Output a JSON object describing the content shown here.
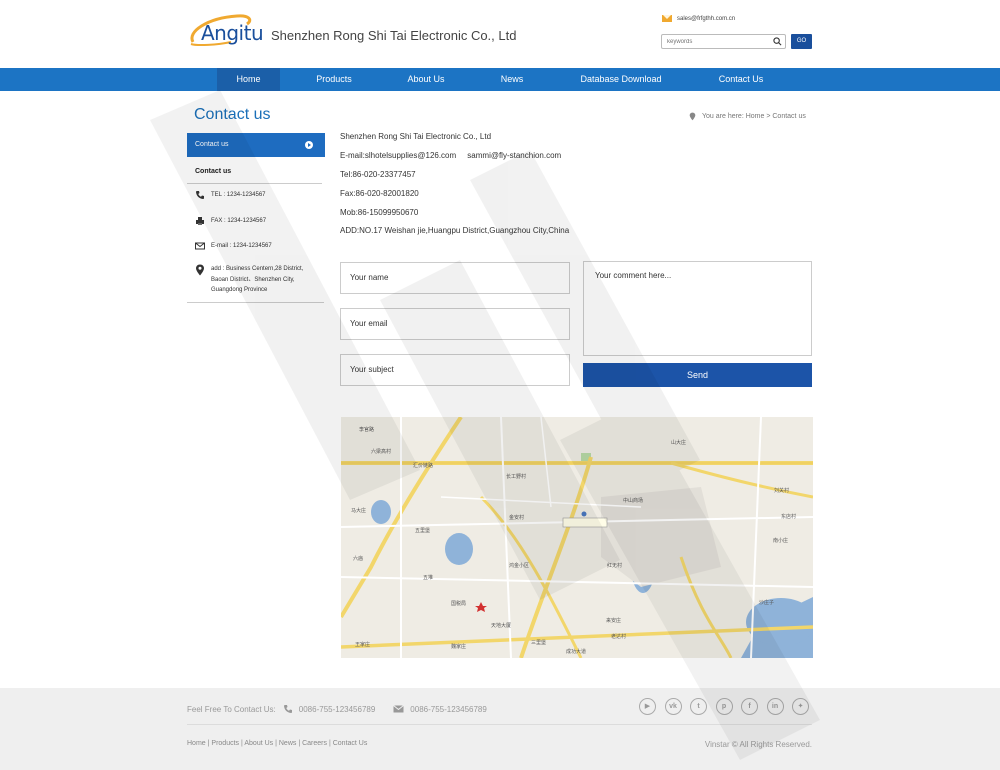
{
  "header": {
    "logo_text": "Angitu",
    "company": "Shenzhen Rong Shi Tai Electronic Co., Ltd",
    "email": "sales@frfgthh.com.cn",
    "search_placeholder": "keywords",
    "go_label": "GO"
  },
  "nav": {
    "items": [
      {
        "label": "Home",
        "active": true
      },
      {
        "label": "Products"
      },
      {
        "label": "About Us"
      },
      {
        "label": "News"
      },
      {
        "label": "Database Download"
      },
      {
        "label": "Contact Us"
      }
    ]
  },
  "sidebar": {
    "page_title": "Contact us",
    "button_label": "Contact us",
    "heading": "Contact us",
    "tel": "TEL : 1234-1234567",
    "fax": "FAX : 1234-1234567",
    "email": "E-mail : 1234-1234567",
    "address": [
      "add : Business Centern,28 District,",
      "Baoan District、Shenzhen City,",
      "Guangdong Province"
    ]
  },
  "breadcrumb": {
    "text": "You are here: Home > Contact us"
  },
  "contact_info": {
    "lines": [
      "Shenzhen Rong Shi Tai Electronic Co., Ltd",
      "E-mail:slhotelsupplies@126.com     sammi@fly-stanchion.com",
      "Tel:86-020-23377457",
      "Fax:86-020-82001820",
      "Mob:86-15099950670",
      "ADD:NO.17 Weishan jie,Huangpu District,Guangzhou City,China"
    ]
  },
  "form": {
    "name_placeholder": "Your name",
    "email_placeholder": "Your email",
    "subject_placeholder": "Your subject",
    "comment_placeholder": "Your comment here...",
    "send_label": "Send"
  },
  "map": {
    "labels": [
      "李官路",
      "六梁高村",
      "汇价链路",
      "朱家庄",
      "马大庄",
      "五里堡",
      "六庙",
      "五堆",
      "科技大道",
      "国税局",
      "天地大厦",
      "来安庄",
      "山大庄",
      "刘关村",
      "东店村",
      "南小庄",
      "沙庄子",
      "老达村",
      "三里堡",
      "成功大道",
      "魏家庄",
      "王家庄",
      "红无村",
      "中山商场",
      "鸿金小区",
      "长工野村",
      "金安村"
    ]
  },
  "footer": {
    "contact_label": "Feel Free To Contact Us:",
    "phone": "0086-755-123456789",
    "email_phone": "0086-755-123456789",
    "links": [
      "Home",
      "Products",
      "About Us",
      "News",
      "Careers",
      "Contact Us"
    ],
    "copyright": "Vinstar © All Rights Reserved.",
    "socials": [
      "youtube-icon",
      "vk-icon",
      "tumblr-icon",
      "pinterest-icon",
      "facebook-icon",
      "linkedin-icon",
      "twitter-icon"
    ]
  }
}
